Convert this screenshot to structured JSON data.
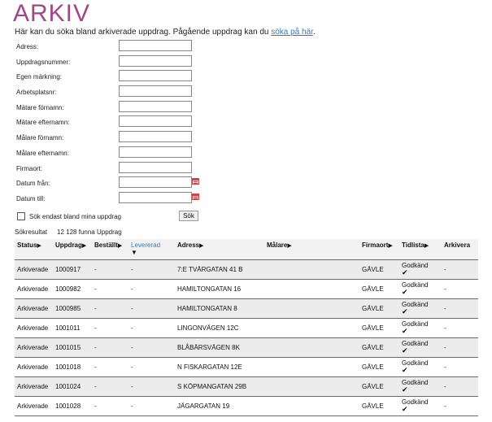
{
  "page": {
    "title": "ARKIV",
    "intro_text": "Här kan du söka bland arkiverade uppdrag. Pågående uppdrag kan du ",
    "intro_link": "söka på här",
    "intro_end": "."
  },
  "form": {
    "fields": [
      {
        "label": "Adress:",
        "value": "",
        "calendar": false
      },
      {
        "label": "Uppdragsnummer:",
        "value": "",
        "calendar": false
      },
      {
        "label": "Egen märkning:",
        "value": "",
        "calendar": false
      },
      {
        "label": "Arbetsplatsnr:",
        "value": "",
        "calendar": false
      },
      {
        "label": "Mätare förnamn:",
        "value": "",
        "calendar": false
      },
      {
        "label": "Mätare efternamn:",
        "value": "",
        "calendar": false
      },
      {
        "label": "Målare förnamn:",
        "value": "",
        "calendar": false
      },
      {
        "label": "Målare efternamn:",
        "value": "",
        "calendar": false
      },
      {
        "label": "Firmaort:",
        "value": "",
        "calendar": false
      },
      {
        "label": "Datum från:",
        "value": "",
        "calendar": true
      },
      {
        "label": "Datum till:",
        "value": "",
        "calendar": true
      }
    ],
    "only_mine_label": "Sök endast bland mina uppdrag",
    "only_mine_checked": false,
    "search_button": "Sök"
  },
  "results": {
    "label": "Sökresultat",
    "count_text": "12 128 funna Uppdrag",
    "columns": [
      {
        "label": "Status",
        "arrow": "▶",
        "sorted": false
      },
      {
        "label": "Uppdrag",
        "arrow": "▶",
        "sorted": false
      },
      {
        "label": "Beställt",
        "arrow": "▶",
        "sorted": false
      },
      {
        "label": "Levererad",
        "arrow": "▼",
        "sorted": true
      },
      {
        "label": "Adress",
        "arrow": "▶",
        "sorted": false
      },
      {
        "label": "Målare",
        "arrow": "▶",
        "sorted": false
      },
      {
        "label": "Firmaort",
        "arrow": "▶",
        "sorted": false
      },
      {
        "label": "Tidlista",
        "arrow": "▶",
        "sorted": false
      },
      {
        "label": "Arkivera",
        "arrow": "",
        "sorted": false
      }
    ],
    "rows": [
      {
        "status": "Arkiverade",
        "uppdrag": "1000917",
        "bestallt": "-",
        "levererad": "-",
        "adress": "7:E TVÄRGATAN 41 B",
        "malare": "",
        "firmaort": "GÄVLE",
        "tidlista": "Godkänd",
        "arkivera": "-"
      },
      {
        "status": "Arkiverade",
        "uppdrag": "1000982",
        "bestallt": "-",
        "levererad": "-",
        "adress": "HAMILTONGATAN 16",
        "malare": "",
        "firmaort": "GÄVLE",
        "tidlista": "Godkänd",
        "arkivera": "-"
      },
      {
        "status": "Arkiverade",
        "uppdrag": "1000985",
        "bestallt": "-",
        "levererad": "-",
        "adress": "HAMILTONGATAN 8",
        "malare": "",
        "firmaort": "GÄVLE",
        "tidlista": "Godkänd",
        "arkivera": "-"
      },
      {
        "status": "Arkiverade",
        "uppdrag": "1001011",
        "bestallt": "-",
        "levererad": "-",
        "adress": "LINGONVÄGEN 12C",
        "malare": "",
        "firmaort": "GÄVLE",
        "tidlista": "Godkänd",
        "arkivera": "-"
      },
      {
        "status": "Arkiverade",
        "uppdrag": "1001015",
        "bestallt": "-",
        "levererad": "-",
        "adress": "BLÅBÄRSVÄGEN 8K",
        "malare": "",
        "firmaort": "GÄVLE",
        "tidlista": "Godkänd",
        "arkivera": "-"
      },
      {
        "status": "Arkiverade",
        "uppdrag": "1001018",
        "bestallt": "-",
        "levererad": "-",
        "adress": "N FISKARGATAN 12E",
        "malare": "",
        "firmaort": "GÄVLE",
        "tidlista": "Godkänd",
        "arkivera": "-"
      },
      {
        "status": "Arkiverade",
        "uppdrag": "1001024",
        "bestallt": "-",
        "levererad": "-",
        "adress": "S KÖPMANGATAN 29B",
        "malare": "",
        "firmaort": "GÄVLE",
        "tidlista": "Godkänd",
        "arkivera": "-"
      },
      {
        "status": "Arkiverade",
        "uppdrag": "1001028",
        "bestallt": "-",
        "levererad": "-",
        "adress": "JÄGARGATAN 19",
        "malare": "",
        "firmaort": "GÄVLE",
        "tidlista": "Godkänd",
        "arkivera": "-"
      }
    ]
  }
}
